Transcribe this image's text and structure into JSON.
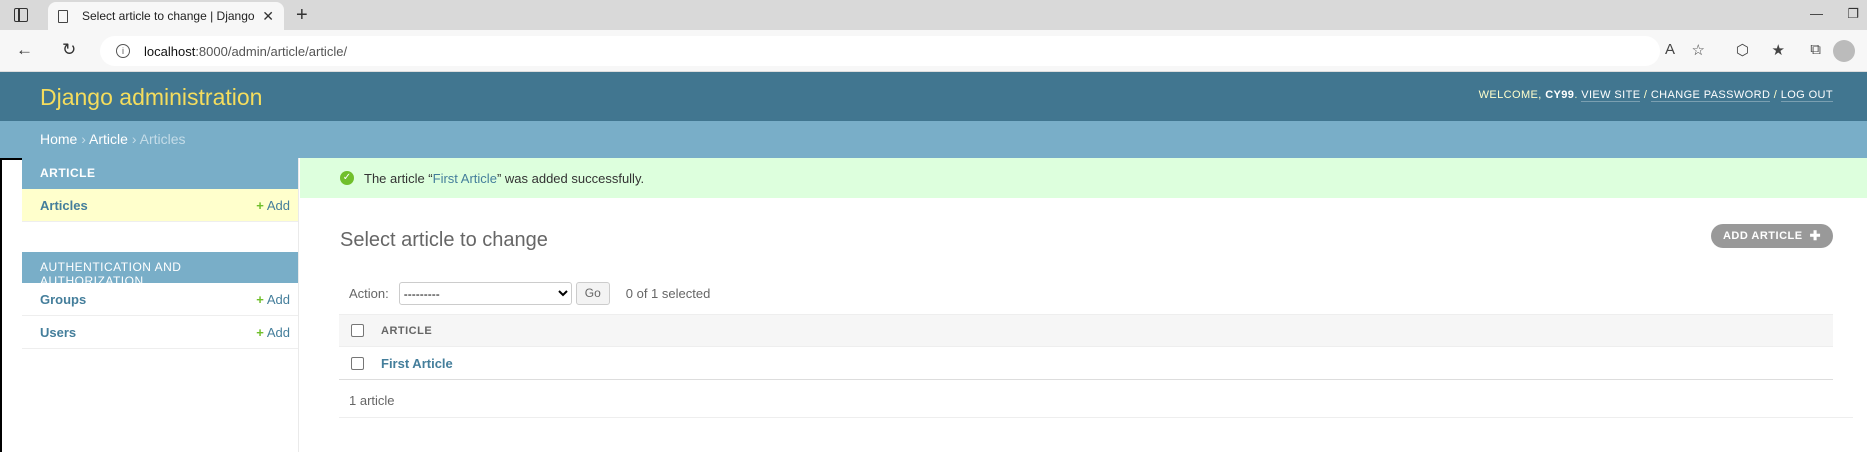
{
  "browser": {
    "tab_title": "Select article to change | Django",
    "url_host": "localhost",
    "url_path": ":8000/admin/article/article/"
  },
  "header": {
    "branding": "Django administration",
    "welcome": "WELCOME,",
    "username": "CY99",
    "view_site": "VIEW SITE",
    "change_password": "CHANGE PASSWORD",
    "log_out": "LOG OUT"
  },
  "breadcrumbs": {
    "home": "Home",
    "app": "Article",
    "current": "Articles"
  },
  "sidebar": {
    "article_caption": "Article",
    "articles_label": "Articles",
    "auth_caption": "Authentication and Authorization",
    "groups_label": "Groups",
    "users_label": "Users",
    "add_label": "Add"
  },
  "message": {
    "prefix": "The article “",
    "link": "First Article",
    "suffix": "” was added successfully."
  },
  "page": {
    "title": "Select article to change",
    "add_button": "ADD ARTICLE"
  },
  "actions": {
    "label": "Action:",
    "selected_option": "---------",
    "go": "Go",
    "counter": "0 of 1 selected"
  },
  "table": {
    "column": "ARTICLE",
    "rows": [
      "First Article"
    ]
  },
  "paginator": "1 article",
  "colors": {
    "header_bg": "#417690",
    "breadcrumb_bg": "#79aec8",
    "branding": "#f5dd5d",
    "success_bg": "#ddffdd",
    "link": "#447e9b",
    "add_green": "#70bf2b"
  }
}
